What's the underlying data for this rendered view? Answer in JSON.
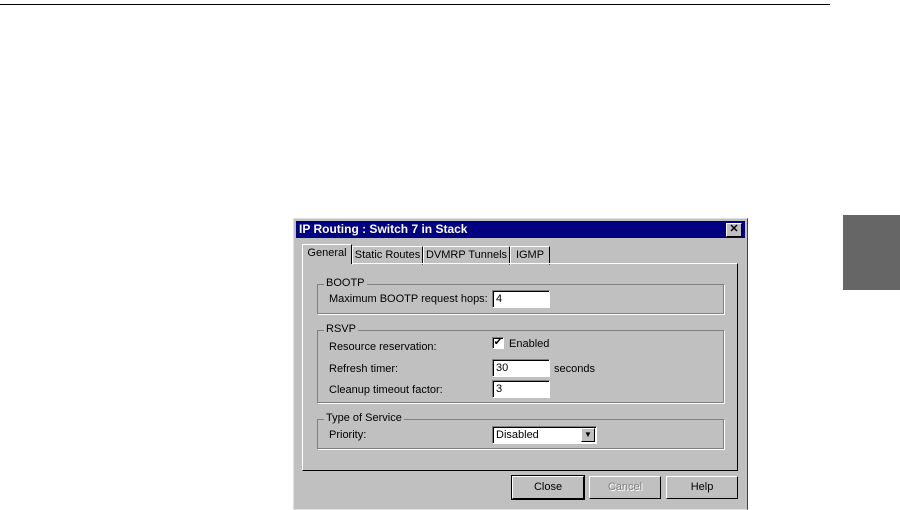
{
  "dialog": {
    "title": "IP Routing : Switch 7 in Stack",
    "close_glyph": "✕",
    "tabs": [
      "General",
      "Static Routes",
      "DVMRP Tunnels",
      "IGMP"
    ],
    "bootp": {
      "legend": "BOOTP",
      "hops_label": "Maximum BOOTP request hops:",
      "hops_value": "4"
    },
    "rsvp": {
      "legend": "RSVP",
      "reservation_label": "Resource reservation:",
      "reservation_checked": true,
      "enabled_label": "Enabled",
      "refresh_label": "Refresh timer:",
      "refresh_value": "30",
      "refresh_unit": "seconds",
      "cleanup_label": "Cleanup timeout factor:",
      "cleanup_value": "3"
    },
    "tos": {
      "legend": "Type of Service",
      "priority_label": "Priority:",
      "priority_value": "Disabled"
    },
    "buttons": {
      "close": "Close",
      "cancel": "Cancel",
      "help": "Help"
    }
  }
}
